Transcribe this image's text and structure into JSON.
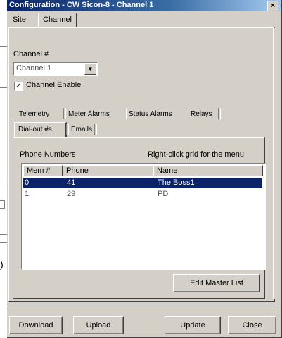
{
  "window": {
    "title": "Configuration - CW Sicon-8 - Channel 1",
    "close_glyph": "×"
  },
  "outer_tabs": [
    {
      "label": "Site",
      "active": false
    },
    {
      "label": "Channel",
      "active": true
    }
  ],
  "channel": {
    "label": "Channel #",
    "selected": "Channel 1",
    "enable_label": "Channel Enable",
    "enable_checked": "✓"
  },
  "inner_tabs": {
    "row1": [
      "Telemetry",
      "Meter Alarms",
      "Status Alarms",
      "Relays"
    ],
    "row2": [
      "Dial-out #s",
      "Emails"
    ],
    "active": "Dial-out #s"
  },
  "phone_section": {
    "title": "Phone Numbers",
    "hint": "Right-click grid for the menu"
  },
  "grid": {
    "columns": [
      "Mem #",
      "Phone",
      "Name"
    ],
    "rows": [
      {
        "mem": "0",
        "phone": "41",
        "name": "The Boss1",
        "selected": true
      },
      {
        "mem": "1",
        "phone": "29",
        "name": "PD",
        "selected": false
      }
    ]
  },
  "buttons": {
    "edit_master": "Edit Master List",
    "download": "Download",
    "upload": "Upload",
    "update": "Update",
    "close": "Close"
  },
  "background": {
    "paren": ")"
  }
}
